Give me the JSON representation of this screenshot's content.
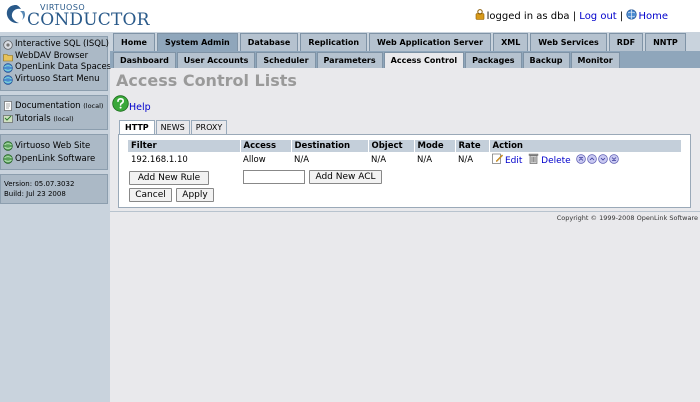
{
  "header": {
    "logo_small": "VIRTUOSO",
    "logo_big": "CONDUCTOR",
    "logged_in_text": "logged in as dba",
    "sep1": "|",
    "logout_label": "Log out",
    "sep2": "|",
    "home_label": "Home"
  },
  "sidebar": {
    "groups": [
      {
        "items": [
          {
            "label": "Interactive SQL (ISQL)",
            "icon": "isql-icon"
          },
          {
            "label": "WebDAV Browser",
            "icon": "folder-icon"
          },
          {
            "label": "OpenLink Data Spaces",
            "icon": "globe-icon"
          },
          {
            "label": "Virtuoso Start Menu",
            "icon": "globe-icon"
          }
        ]
      },
      {
        "items": [
          {
            "label": "Documentation",
            "suffix": "(local)",
            "icon": "document-icon"
          },
          {
            "label": "Tutorials",
            "suffix": "(local)",
            "icon": "tutorial-icon"
          }
        ]
      },
      {
        "items": [
          {
            "label": "Virtuoso Web Site",
            "icon": "globe-icon"
          },
          {
            "label": "OpenLink Software",
            "icon": "globe-icon"
          }
        ]
      }
    ],
    "version": "Version: 05.07.3032",
    "build": "Build: Jul 23 2008"
  },
  "tabs_primary": [
    "Home",
    "System Admin",
    "Database",
    "Replication",
    "Web Application Server",
    "XML",
    "Web Services",
    "RDF",
    "NNTP"
  ],
  "tabs_primary_active": "System Admin",
  "tabs_secondary": [
    "Dashboard",
    "User Accounts",
    "Scheduler",
    "Parameters",
    "Access Control",
    "Packages",
    "Backup",
    "Monitor"
  ],
  "tabs_secondary_active": "Access Control",
  "page_title": "Access Control Lists",
  "help_label": "Help",
  "protocol_tabs": [
    "HTTP",
    "NEWS",
    "PROXY"
  ],
  "protocol_tabs_active": "HTTP",
  "table": {
    "columns": [
      "Filter",
      "Access",
      "Destination",
      "Object",
      "Mode",
      "Rate",
      "Action"
    ],
    "rows": [
      {
        "filter": "192.168.1.10",
        "access": "Allow",
        "destination": "N/A",
        "object": "N/A",
        "mode": "N/A",
        "rate": "N/A",
        "edit_label": "Edit",
        "delete_label": "Delete"
      }
    ]
  },
  "buttons": {
    "add_rule": "Add New Rule",
    "add_acl": "Add New ACL",
    "cancel": "Cancel",
    "apply": "Apply"
  },
  "acl_input_value": "",
  "footer": "Copyright © 1999-2008 OpenLink Software",
  "colors": {
    "accent_link": "#0000cc",
    "sidebar_bg": "#c9d3dd",
    "tab_bar_secondary": "#8fa6bb",
    "title_gray": "#9a9a9a"
  }
}
